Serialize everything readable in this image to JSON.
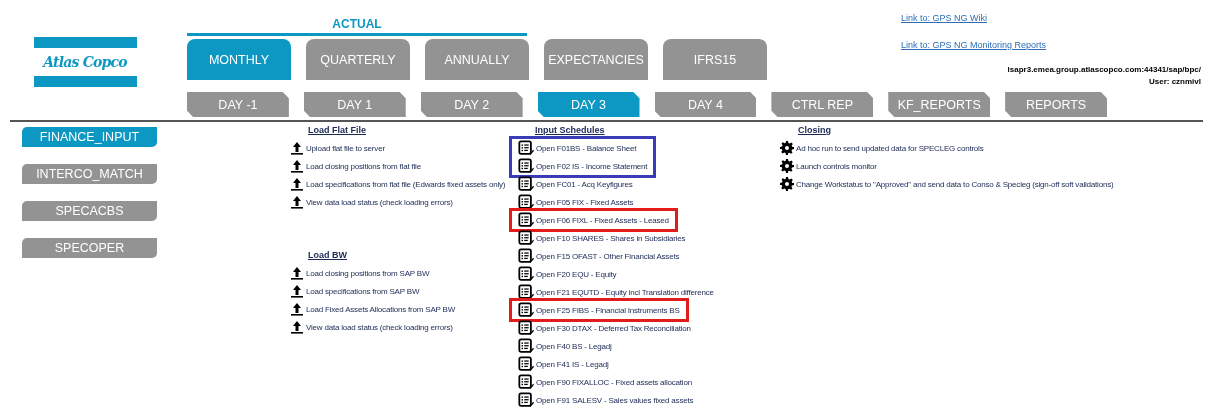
{
  "logo": {
    "text": "Atlas Copco"
  },
  "group_label": "ACTUAL",
  "period_tabs": [
    {
      "label": "MONTHLY",
      "selected": true
    },
    {
      "label": "QUARTERLY",
      "selected": false
    },
    {
      "label": "ANNUALLY",
      "selected": false
    },
    {
      "label": "EXPECTANCIES",
      "selected": false
    },
    {
      "label": "IFRS15",
      "selected": false
    }
  ],
  "day_tabs": [
    {
      "label": "DAY -1",
      "selected": false
    },
    {
      "label": "DAY 1",
      "selected": false
    },
    {
      "label": "DAY 2",
      "selected": false
    },
    {
      "label": "DAY 3",
      "selected": true
    },
    {
      "label": "DAY 4",
      "selected": false
    },
    {
      "label": "CTRL REP",
      "selected": false
    },
    {
      "label": "KF_REPORTS",
      "selected": false
    },
    {
      "label": "REPORTS",
      "selected": false
    }
  ],
  "links": [
    "Link to: GPS NG Wiki",
    "Link to: GPS NG Monitoring Reports"
  ],
  "server": "lsapr3.emea.group.atlascopco.com:44341/sap/bpc/",
  "user": "User: cznmivl",
  "sidebar": [
    {
      "label": "FINANCE_INPUT",
      "selected": true
    },
    {
      "label": "INTERCO_MATCH",
      "selected": false
    },
    {
      "label": "SPECACBS",
      "selected": false
    },
    {
      "label": "SPECOPER",
      "selected": false
    }
  ],
  "load_sections": [
    {
      "title": "Load Flat File",
      "items": [
        "Upload flat file to server",
        "Load closing positions from flat file",
        "Load specifications from flat file (Edwards fixed assets only)",
        "View data load status (check loading errors)"
      ]
    },
    {
      "title": "Load BW",
      "items": [
        "Load closing positions from SAP BW",
        "Load specifications from SAP BW",
        "Load Fixed Assets Allocations from SAP BW",
        "View data load status (check loading errors)"
      ]
    }
  ],
  "input_schedules": {
    "title": "Input Schedules",
    "groups": [
      {
        "color": "#3b3bb8",
        "items": [
          "Open F01BS - Balance Sheet",
          "Open F02 IS - Income Statement"
        ]
      },
      {
        "items": [
          "Open FC01 - Acq Keyfigures",
          "Open F05 FIX - Fixed Assets"
        ]
      },
      {
        "color": "#e21b1b",
        "items": [
          "Open F06 FIXL - Fixed Assets - Leased"
        ]
      },
      {
        "items": [
          "Open F10 SHARES - Shares in Subsidiaries",
          "Open F15 OFAST - Other Financial Assets",
          "Open F20 EQU - Equity",
          "Open F21 EQUTD - Equity incl Translation difference"
        ]
      },
      {
        "color": "#e21b1b",
        "items": [
          "Open F25 FIBS - Financial Instruments BS"
        ]
      },
      {
        "items": [
          "Open F30 DTAX - Deferred Tax Reconciliation",
          "Open F40 BS - Legadj",
          "Open F41 IS - Legadj",
          "Open F90 FIXALLOC - Fixed assets allocation",
          "Open F91 SALESV - Sales values fixed assets"
        ]
      }
    ]
  },
  "closing": {
    "title": "Closing",
    "items": [
      "Ad hoc run to send updated data for SPECLEG controls",
      "Launch controls monitor",
      "Change Workstatus to \"Approved\" and send data to Conso & Specleg (sign-off soft validations)"
    ]
  }
}
